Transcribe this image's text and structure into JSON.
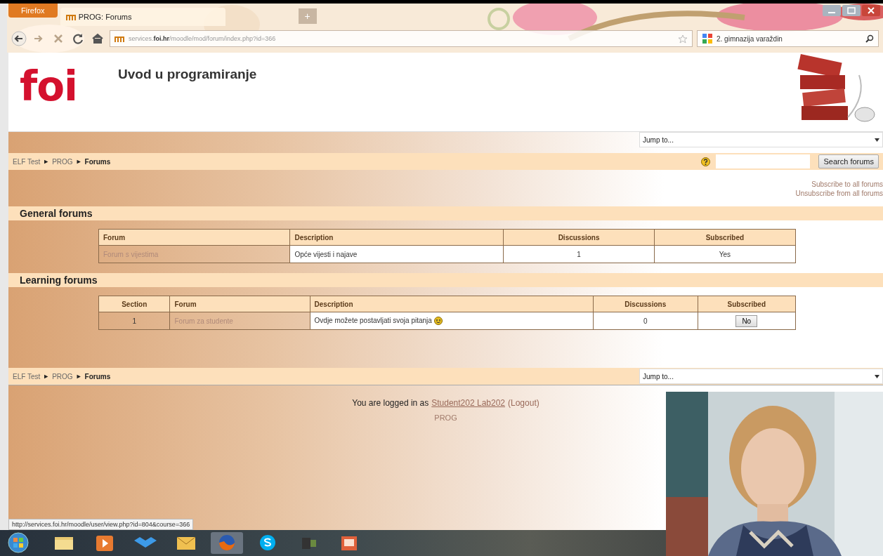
{
  "browser": {
    "menu_button": "Firefox",
    "tab": {
      "title": "PROG: Forums",
      "selected": true
    },
    "new_tab": "+",
    "address": "services.**foi.hr**/moodle/mod/forum/index.php?id=366",
    "search_value": "2. gimnazija varaždin"
  },
  "header": {
    "logo": "foi",
    "course_title": "Uvod u programiranje",
    "jump_to": "Jump to..."
  },
  "breadcrumb": {
    "separator": "►",
    "items": [
      "ELF Test",
      "PROG",
      "Forums"
    ]
  },
  "search": {
    "button": "Search forums"
  },
  "subscribe_links": [
    "Subscribe to all forums",
    "Unsubscribe from all forums"
  ],
  "sections": [
    {
      "title": "General forums",
      "columns": [
        {
          "label": "Forum",
          "kind": "forum"
        },
        {
          "label": "Description",
          "kind": "description"
        },
        {
          "label": "Discussions",
          "kind": "discussions"
        },
        {
          "label": "Subscribed",
          "kind": "subscribed"
        }
      ],
      "rows": [
        {
          "forum": "Forum s vijestima",
          "description": "Opće vijesti i najave",
          "smiley": false,
          "discussions": "1",
          "subscribed": {
            "kind": "text",
            "label": "Yes"
          }
        }
      ]
    },
    {
      "title": "Learning forums",
      "columns": [
        {
          "label": "Section",
          "kind": "section"
        },
        {
          "label": "Forum",
          "kind": "forum"
        },
        {
          "label": "Description",
          "kind": "description"
        },
        {
          "label": "Discussions",
          "kind": "discussions"
        },
        {
          "label": "Subscribed",
          "kind": "subscribed"
        }
      ],
      "rows": [
        {
          "section": "1",
          "forum": "Forum za studente",
          "description": "Ovdje možete postavljati svoja pitanja",
          "smiley": true,
          "discussions": "0",
          "subscribed": {
            "kind": "button",
            "label": "No"
          }
        }
      ]
    }
  ],
  "bottom_breadcrumb": {
    "separator": "►",
    "items": [
      "ELF Test",
      "PROG",
      "Forums"
    ],
    "jump_to": "Jump to..."
  },
  "footer": {
    "logged_in": "You are logged in as",
    "user": "Student202 Lab202",
    "logout": "(Logout)",
    "course": "PROG"
  },
  "status_bar": "http://services.foi.hr/moodle/user/view.php?id=804&course=366",
  "webcam": {
    "kind": "picture"
  }
}
